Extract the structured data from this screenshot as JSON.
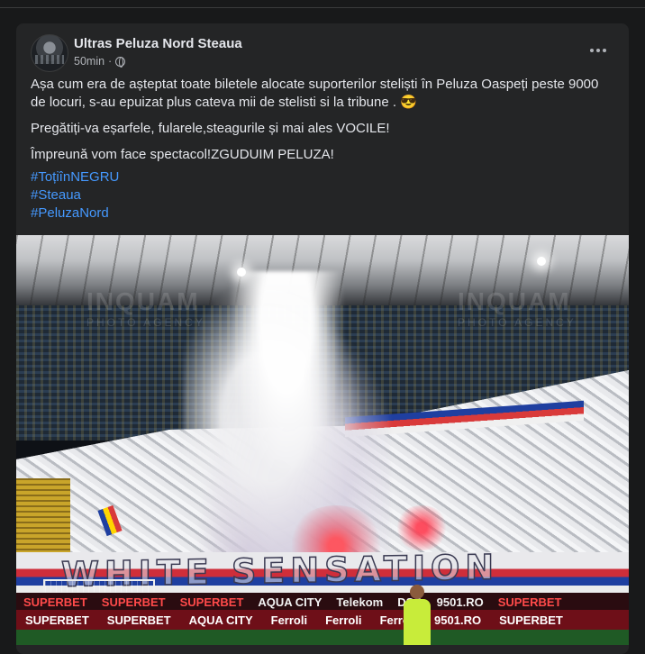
{
  "post": {
    "author": "Ultras Peluza Nord Steaua",
    "time": "50min",
    "dot": "·",
    "paragraphs": [
      "Așa cum era de așteptat toate biletele alocate suporterilor steliști în Peluza Oaspeți  peste  9000 de locuri, s-au epuizat plus cateva mii de stelisti si la  tribune . 😎",
      "Pregătiți-va eșarfele, fularele,steagurile și mai ales VOCILE!",
      "Împreună vom face spectacol!ZGUDUIM PELUZA!"
    ],
    "hashtags": [
      "#ToțiînNEGRU",
      "#Steaua",
      "#PeluzaNord"
    ]
  },
  "photo": {
    "watermark_left": "INQUAM",
    "watermark_left_sub": "PHOTO AGENCY",
    "watermark_right": "INQUAM",
    "watermark_right_sub": "PHOTO AGENCY",
    "banner_text": "WHITE SENSATION",
    "ads_row1": [
      "SUPERBET",
      "SUPERBET",
      "SUPERBET",
      "AQUA CITY",
      "Telekom",
      "DSC",
      "9501.RO",
      "SUPERBET"
    ],
    "ads_row2": [
      "SUPERBET",
      "SUPERBET",
      "AQUA CITY",
      "Ferroli",
      "Ferroli",
      "Ferroli",
      "9501.RO",
      "SUPERBET"
    ]
  },
  "icons": {
    "privacy": "globe-icon",
    "menu": "more-options-icon"
  },
  "colors": {
    "background": "#18191a",
    "card": "#242526",
    "link": "#4599ff",
    "text": "#e4e6eb",
    "muted": "#b0b3b8"
  }
}
